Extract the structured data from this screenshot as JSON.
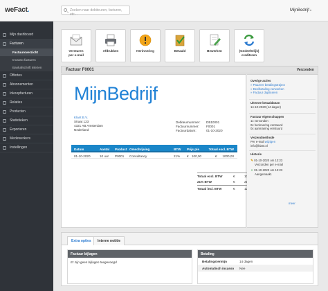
{
  "app": {
    "logo_main": "weFact",
    "logo_dot": ".",
    "company_name": "MijnBedrijf",
    "caret": "▾"
  },
  "search": {
    "placeholder": "Zoeken naar debiteuren, facturen, etc..."
  },
  "sidebar": {
    "items": [
      {
        "label": "Mijn dashboard",
        "icon": "dashboard-icon"
      },
      {
        "label": "Facturen",
        "icon": "invoice-icon",
        "active": true
      },
      {
        "label": "Offertes",
        "icon": "quote-icon"
      },
      {
        "label": "Abonnementen",
        "icon": "subscription-icon"
      },
      {
        "label": "Inkoopfacturen",
        "icon": "purchase-invoice-icon"
      },
      {
        "label": "Relaties",
        "icon": "relations-icon"
      },
      {
        "label": "Producten",
        "icon": "products-icon"
      },
      {
        "label": "Statistieken",
        "icon": "statistics-icon"
      },
      {
        "label": "Exporteren",
        "icon": "export-icon"
      },
      {
        "label": "Medewerkers",
        "icon": "employees-icon"
      },
      {
        "label": "Instellingen",
        "icon": "settings-icon"
      }
    ],
    "subitems": [
      {
        "label": "Factuuroverzicht",
        "active": true
      },
      {
        "label": "Incasso facturen"
      },
      {
        "label": "Bankafschrift inlezen"
      }
    ]
  },
  "toolbar": {
    "buttons": [
      {
        "line1": "Versturen",
        "line2": "per e-mail",
        "icon": "email-icon"
      },
      {
        "line1": "Afdrukken",
        "line2": "",
        "icon": "printer-icon"
      },
      {
        "line1": "Herinnering",
        "line2": "",
        "icon": "warning-icon"
      },
      {
        "line1": "Betaald",
        "line2": "",
        "icon": "paid-icon"
      },
      {
        "line1": "Bewerken",
        "line2": "",
        "icon": "edit-icon"
      },
      {
        "line1": "(Gedeeltelijk)",
        "line2": "crediteren",
        "icon": "credit-arrows-icon"
      }
    ]
  },
  "invoice": {
    "title": "Factuur F0001",
    "status": "Verzonden",
    "brand": "MijnBedrijf",
    "customer": {
      "name": "Klant B.V.",
      "street": "Straat 123",
      "city": "4321 AB  Amsterdam",
      "country": "Nederland"
    },
    "meta": [
      {
        "label": "Debiteurnummer:",
        "value": "DB10001"
      },
      {
        "label": "Factuurnummer:",
        "value": "F0001"
      },
      {
        "label": "Factuurdatum:",
        "value": "01-10-2020"
      }
    ],
    "table": {
      "headers": [
        "Datum",
        "Aantal",
        "Product",
        "Omschrijving",
        "BTW",
        "Prijs p/e",
        "",
        "Totaal excl. BTW"
      ],
      "rows": [
        {
          "datum": "01-10-2020",
          "aantal": "10 uur",
          "product": "P0001",
          "omschrijving": "Consultancy",
          "btw": "21%",
          "cur1": "€",
          "prijs": "100,00",
          "cur2": "€",
          "totaal": "1000,00"
        }
      ]
    },
    "totals": [
      {
        "label": "Totaal excl. BTW",
        "currency": "€",
        "value": "1000,00"
      },
      {
        "label": "21% BTW",
        "currency": "€",
        "value": "210,00"
      },
      {
        "label": "Totaal incl. BTW",
        "currency": "€",
        "value": "1210,00"
      }
    ]
  },
  "side": {
    "actions_title": "Overige acties",
    "actions": [
      "» Pauzeer betalingstraject",
      "» Deelbetaling verwerken",
      "» Factuur dupliceren"
    ],
    "due_title": "Uiterste betaaldatum",
    "due_value": "14-10-2020 (14 dagen)",
    "props_title": "Factuur eigenschappen",
    "props": [
      "1x verzonden",
      "0x herinnering verstuurd",
      "0x aanmaning verstuurd"
    ],
    "send_title": "Verzendmethode",
    "send_line1": "Per e-mail",
    "send_link": "wijzigen",
    "send_email": "info@klant.nl",
    "history_title": "Historie",
    "history": [
      {
        "mark": "✎",
        "date": "01-10-2020 om 13:23",
        "text": "Verzonden per e-mail"
      },
      {
        "mark": "+",
        "date": "01-10-2020 om 13:23",
        "text": "Aangemaakt."
      }
    ],
    "more": "meer"
  },
  "bottom": {
    "tabs": [
      "Extra opties",
      "Interne notitie"
    ],
    "attachments_title": "Factuur bijlagen",
    "attachments_empty": "Er zijn geen bijlagen toegevoegd",
    "payment_title": "Betaling",
    "payment_rows": [
      {
        "label": "Betalingstermijn",
        "value": "14 dagen"
      },
      {
        "label": "Automatisch incasso",
        "value": "Nee"
      }
    ]
  }
}
